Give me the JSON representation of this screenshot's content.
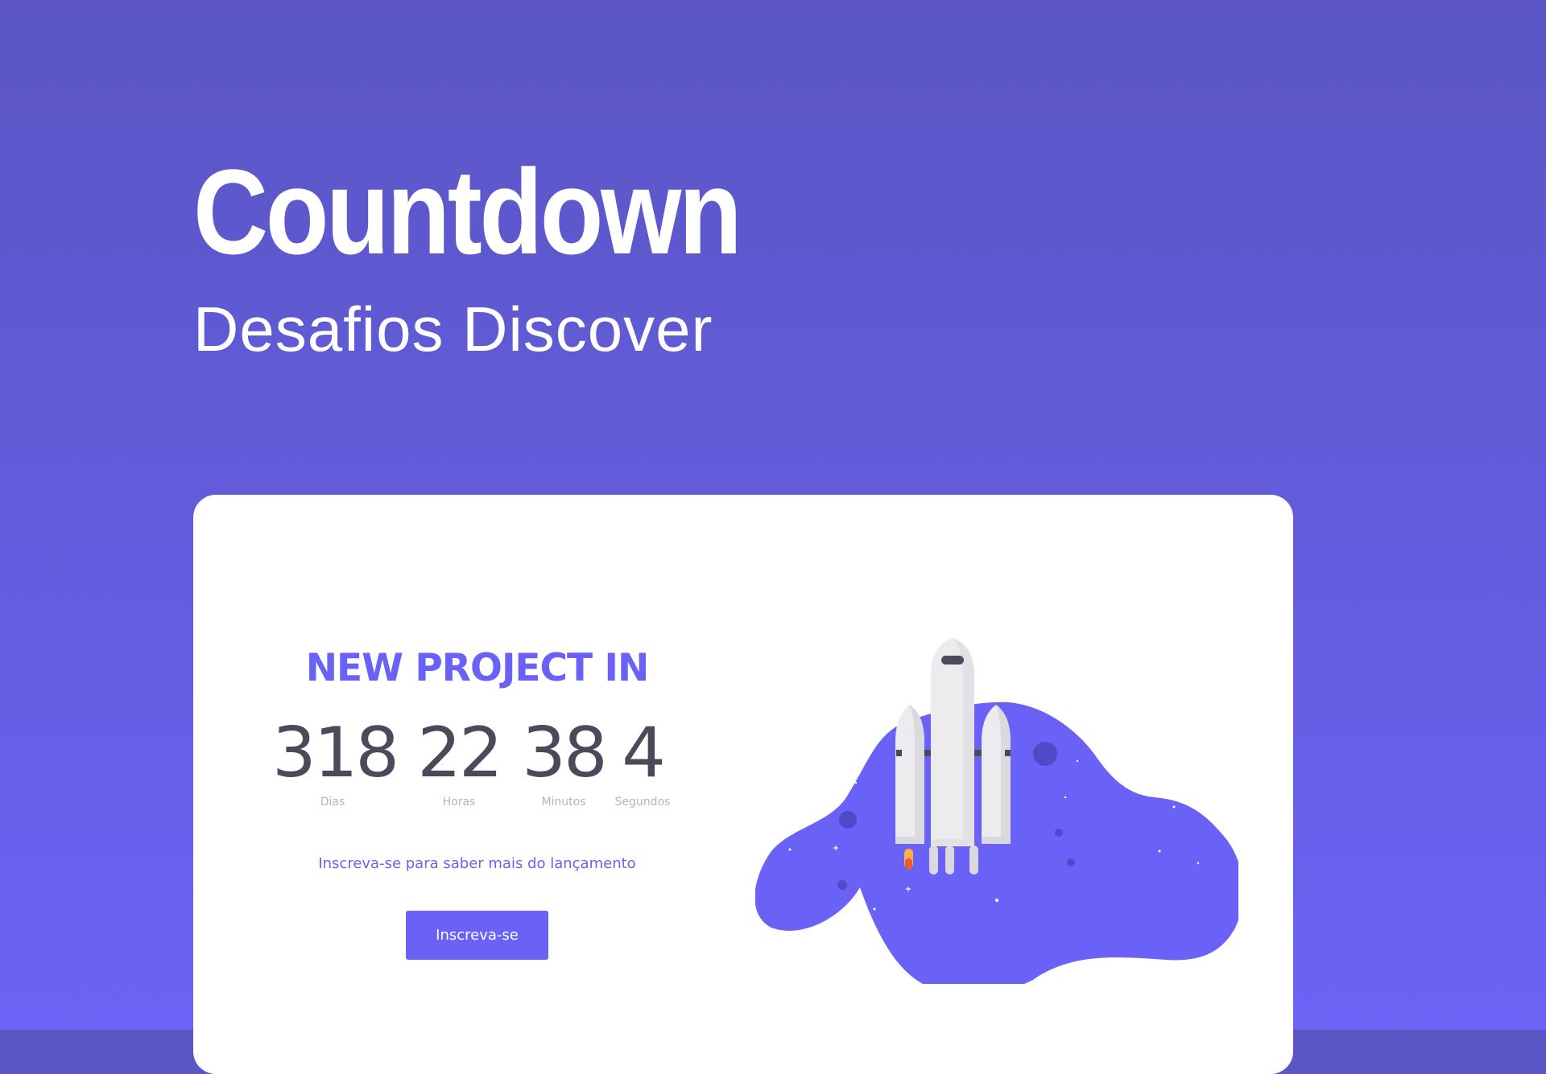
{
  "hero": {
    "title": "Countdown",
    "subtitle": "Desafios Discover"
  },
  "card": {
    "heading": "NEW PROJECT IN",
    "countdown": {
      "days": {
        "value": "318",
        "label": "Dias"
      },
      "hours": {
        "value": "22",
        "label": "Horas"
      },
      "minutes": {
        "value": "38",
        "label": "Minutos"
      },
      "seconds": {
        "value": "4",
        "label": "Segundos"
      }
    },
    "cta_text": "Inscreva-se para saber mais do lançamento",
    "button_label": "Inscreva-se",
    "illustration": "rocket-launch-illustration"
  },
  "colors": {
    "background_top": "#5a55c3",
    "background_bottom": "#6b63f5",
    "accent": "#6a61f6",
    "number_text": "#4a4a5a",
    "label_text": "#b4b4bc",
    "card": "#ffffff"
  }
}
